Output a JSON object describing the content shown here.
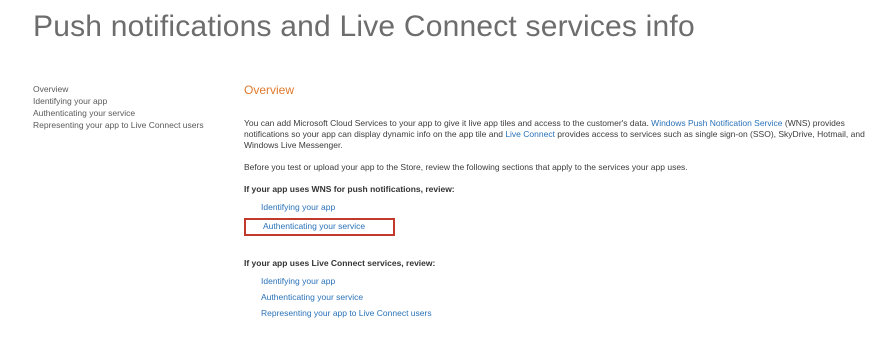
{
  "page": {
    "title": "Push notifications and Live Connect services info"
  },
  "sidebar": {
    "items": [
      {
        "label": "Overview"
      },
      {
        "label": "Identifying your app"
      },
      {
        "label": "Authenticating your service"
      },
      {
        "label": "Representing your app to Live Connect users"
      }
    ]
  },
  "main": {
    "heading": "Overview",
    "intro": {
      "text1": "You can add Microsoft Cloud Services to your app to give it live app tiles and access to the customer's data. ",
      "link1": "Windows Push Notification Service",
      "text2": " (WNS) provides notifications so your app can display dynamic info on the app tile and ",
      "link2": "Live Connect",
      "text3": " provides access to services such as single sign-on (SSO), SkyDrive, Hotmail, and Windows Live Messenger."
    },
    "before_text": "Before you test or upload your app to the Store, review the following sections that apply to the services your app uses.",
    "wns": {
      "heading": "If your app uses WNS for push notifications, review:",
      "links": [
        "Identifying your app",
        "Authenticating your service"
      ]
    },
    "live": {
      "heading": "If your app uses Live Connect services, review:",
      "links": [
        "Identifying your app",
        "Authenticating your service",
        "Representing your app to Live Connect users"
      ]
    }
  },
  "colors": {
    "heading_accent": "#e07a2e",
    "link": "#2a72b8",
    "highlight_box": "#c0392b"
  }
}
